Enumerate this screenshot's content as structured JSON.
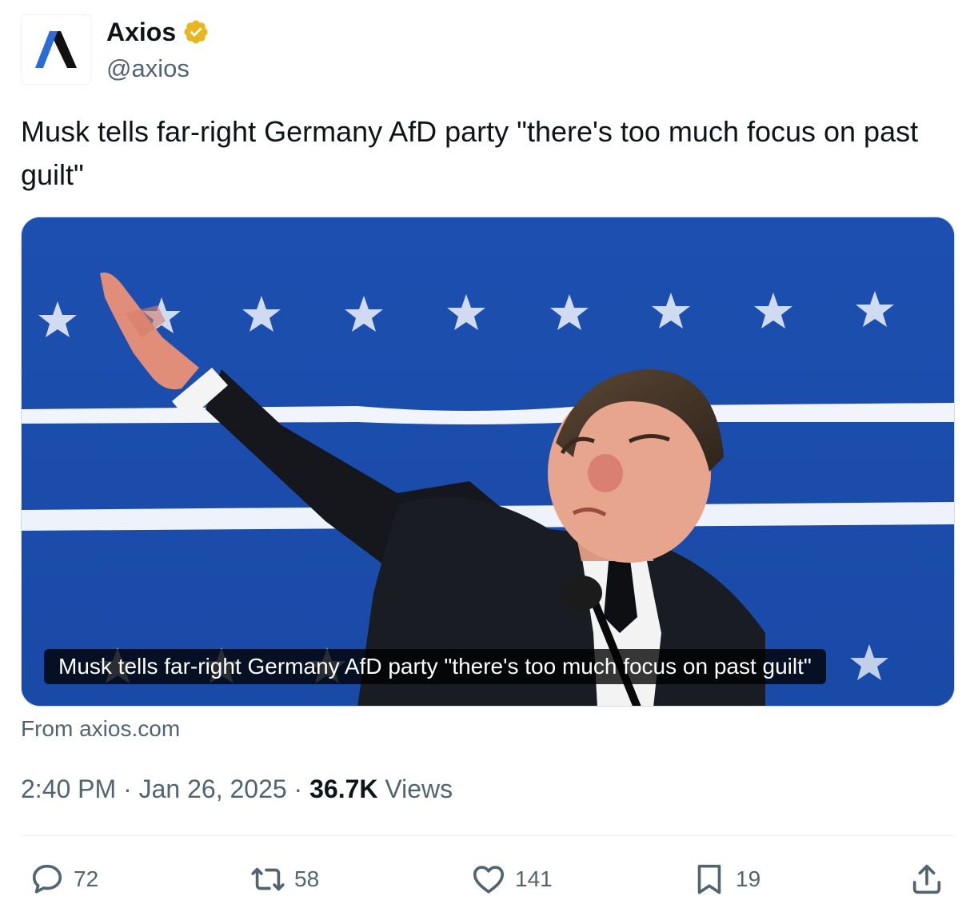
{
  "author": {
    "display_name": "Axios",
    "handle": "@axios",
    "avatar_icon": "axios-logo-icon",
    "verified_icon": "verified-badge-icon",
    "verified_color": "#e8b720"
  },
  "tweet": {
    "text": "Musk tells far-right Germany AfD party \"there's too much focus on past guilt\""
  },
  "media": {
    "caption": "Musk tells far-right Germany AfD party \"there's too much focus on past guilt\"",
    "source": "From axios.com"
  },
  "meta": {
    "time": "2:40 PM",
    "separator": "·",
    "date": "Jan 26, 2025",
    "views_count": "36.7K",
    "views_label": "Views"
  },
  "actions": {
    "reply": {
      "icon": "reply-icon",
      "count": "72"
    },
    "retweet": {
      "icon": "retweet-icon",
      "count": "58"
    },
    "like": {
      "icon": "heart-icon",
      "count": "141"
    },
    "bookmark": {
      "icon": "bookmark-icon",
      "count": "19"
    },
    "share": {
      "icon": "share-icon"
    }
  },
  "colors": {
    "text_primary": "#0f1419",
    "text_secondary": "#536471",
    "backdrop_blue": "#1e53b8"
  }
}
